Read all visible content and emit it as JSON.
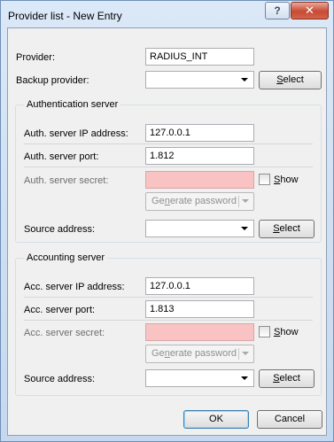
{
  "window": {
    "title": "Provider list - New Entry",
    "help_glyph": "?",
    "close_glyph": "✕"
  },
  "provider": {
    "label": "Provider:",
    "value": "RADIUS_INT"
  },
  "backup_provider": {
    "label": "Backup provider:",
    "value": "",
    "select_label": "Select",
    "select_mnemonic": "S",
    "select_rest": "elect"
  },
  "auth": {
    "group_title": "Authentication server",
    "ip_label": "Auth. server IP address:",
    "ip_value": "127.0.0.1",
    "port_label": "Auth. server port:",
    "port_value": "1.812",
    "secret_label": "Auth. server secret:",
    "secret_value": "",
    "show_label": "Show",
    "show_mnemonic": "S",
    "show_rest": "how",
    "show_checked": false,
    "generate_pre": "Ge",
    "generate_mnemonic": "n",
    "generate_post": "erate password",
    "source_label": "Source address:",
    "source_value": "",
    "select_mnemonic": "S",
    "select_rest": "elect"
  },
  "acct": {
    "group_title": "Accounting server",
    "ip_label": "Acc. server IP address:",
    "ip_value": "127.0.0.1",
    "port_label": "Acc. server port:",
    "port_value": "1.813",
    "secret_label": "Acc. server secret:",
    "secret_value": "",
    "show_label": "Show",
    "show_mnemonic": "S",
    "show_rest": "how",
    "show_checked": false,
    "generate_pre": "Ge",
    "generate_mnemonic": "n",
    "generate_post": "erate password",
    "source_label": "Source address:",
    "source_value": "",
    "select_mnemonic": "S",
    "select_rest": "elect"
  },
  "footer": {
    "ok_label": "OK",
    "cancel_label": "Cancel"
  },
  "colors": {
    "secret_field_bg": "#f9c3c3",
    "title_bar": "#c5d8ee",
    "close_button": "#c74a32"
  }
}
